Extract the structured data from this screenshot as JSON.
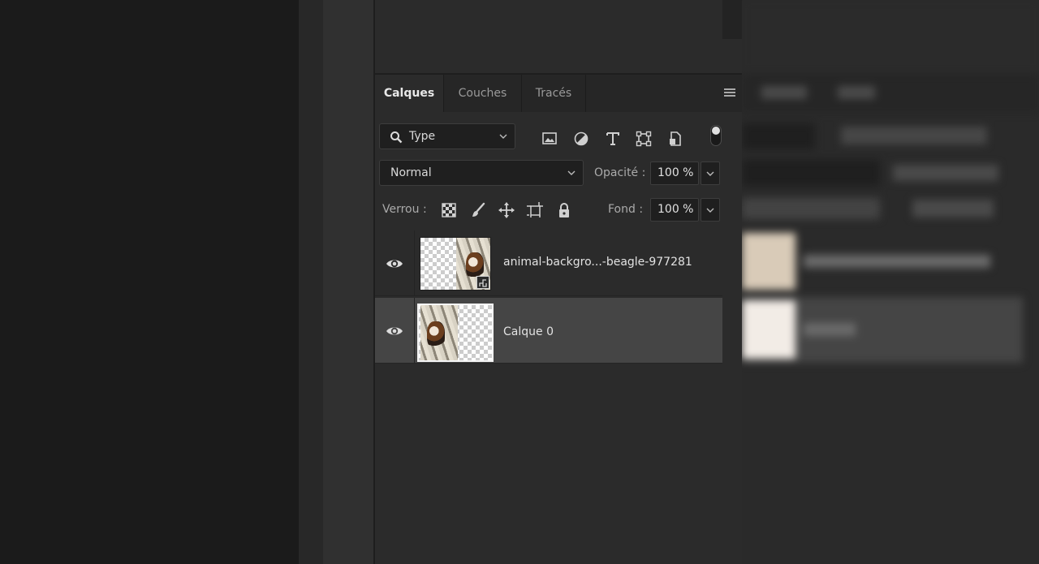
{
  "tabs": [
    {
      "label": "Calques",
      "active": true
    },
    {
      "label": "Couches",
      "active": false
    },
    {
      "label": "Tracés",
      "active": false
    }
  ],
  "filter": {
    "kind_label": "Type",
    "icons": [
      "image-filter-icon",
      "adjustment-filter-icon",
      "type-filter-icon",
      "shape-filter-icon",
      "smart-object-filter-icon"
    ]
  },
  "blend": {
    "mode": "Normal",
    "opacity_label": "Opacité :",
    "opacity_value": "100 %"
  },
  "lock": {
    "label": "Verrou :",
    "icons": [
      "lock-transparent-pixels-icon",
      "lock-image-pixels-icon",
      "lock-position-icon",
      "lock-artboard-icon",
      "lock-all-icon"
    ],
    "fill_label": "Fond :",
    "fill_value": "100 %"
  },
  "layers": [
    {
      "name": "animal-backgro...-beagle-977281",
      "visible": true,
      "selected": false,
      "type": "smart-object"
    },
    {
      "name": "Calque 0",
      "visible": true,
      "selected": true,
      "type": "pixel"
    }
  ],
  "colors": {
    "panel_bg": "#2b2b2b",
    "tabbar_bg": "#262626",
    "selected_row": "#454545",
    "input_bg": "#1f1f1f"
  }
}
